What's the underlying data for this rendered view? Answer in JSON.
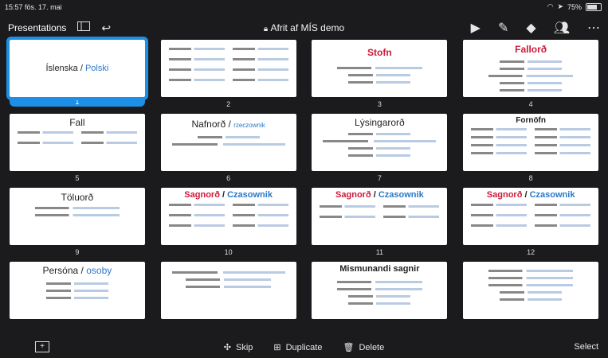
{
  "status": {
    "time": "15:57",
    "date": "fös. 17. mai",
    "battery": "75%"
  },
  "toolbar": {
    "left_label": "Presentations",
    "doc_title": "Afrit af MÍS demo",
    "lock_icon": "lock-icon"
  },
  "slides": [
    {
      "num": "1",
      "title_a": "Íslenska",
      "sep": " / ",
      "title_b": "Polski",
      "selected": true
    },
    {
      "num": "2",
      "title_a": "",
      "sep": "",
      "title_b": ""
    },
    {
      "num": "3",
      "title_a": "Stofn",
      "sep": "",
      "title_b": ""
    },
    {
      "num": "4",
      "title_a": "Fallorð",
      "sep": "",
      "title_b": ""
    },
    {
      "num": "5",
      "title_a": "Fall",
      "sep": "",
      "title_b": ""
    },
    {
      "num": "6",
      "title_a": "Nafnorð",
      "sep": " / ",
      "title_b": "rzeczownik"
    },
    {
      "num": "7",
      "title_a": "Lýsingarorð",
      "sep": "",
      "title_b": ""
    },
    {
      "num": "8",
      "title_a": "Fornöfn",
      "sep": "",
      "title_b": ""
    },
    {
      "num": "9",
      "title_a": "Töluorð",
      "sep": "",
      "title_b": ""
    },
    {
      "num": "10",
      "title_a": "Sagnorð",
      "sep": " / ",
      "title_b": "Czasownik"
    },
    {
      "num": "11",
      "title_a": "Sagnorð",
      "sep": " / ",
      "title_b": "Czasownik"
    },
    {
      "num": "12",
      "title_a": "Sagnorð",
      "sep": " / ",
      "title_b": "Czasownik"
    },
    {
      "num": "",
      "title_a": "Persóna",
      "sep": " / ",
      "title_b": "osoby"
    },
    {
      "num": "",
      "title_a": "",
      "sep": "",
      "title_b": ""
    },
    {
      "num": "",
      "title_a": "Mismunandi sagnir",
      "sep": "",
      "title_b": ""
    },
    {
      "num": "",
      "title_a": "",
      "sep": "",
      "title_b": ""
    }
  ],
  "bottom": {
    "skip_label": "Skip",
    "duplicate_label": "Duplicate",
    "delete_label": "Delete",
    "select_label": "Select"
  }
}
